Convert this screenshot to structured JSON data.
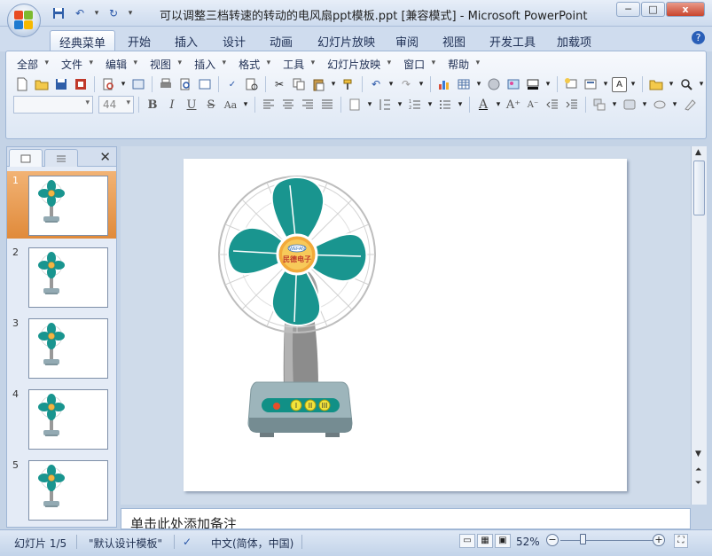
{
  "window": {
    "title": "可以调整三档转速的转动的电风扇ppt模板.ppt [兼容模式] - Microsoft PowerPoint",
    "minimize_label": "─",
    "maximize_label": "□",
    "close_label": "x"
  },
  "ribbon_tabs": [
    "经典菜单",
    "开始",
    "插入",
    "设计",
    "动画",
    "幻灯片放映",
    "审阅",
    "视图",
    "开发工具",
    "加载项"
  ],
  "menus": [
    "全部",
    "文件",
    "编辑",
    "视图",
    "插入",
    "格式",
    "工具",
    "幻灯片放映",
    "窗口",
    "帮助"
  ],
  "font_size_value": "44",
  "format_buttons": {
    "bold": "B",
    "italic": "I",
    "underline": "U",
    "strike": "S",
    "aa": "Aa",
    "font_color": "A"
  },
  "help_label": "?",
  "slides": [
    {
      "number": "1"
    },
    {
      "number": "2"
    },
    {
      "number": "3"
    },
    {
      "number": "4"
    },
    {
      "number": "5"
    }
  ],
  "fan": {
    "logo_line1": "WEFAN",
    "logo_line2": "民德电子",
    "speed_labels": [
      "I",
      "II",
      "III"
    ]
  },
  "notes_placeholder": "单击此处添加备注",
  "status": {
    "slide_indicator": "幻灯片 1/5",
    "theme": "\"默认设计模板\"",
    "language": "中文(简体，中国)",
    "zoom": "52%"
  },
  "colors": {
    "fan_teal": "#19958f",
    "accent_orange": "#e8913c",
    "ribbon_blue": "#c4d3e6"
  }
}
